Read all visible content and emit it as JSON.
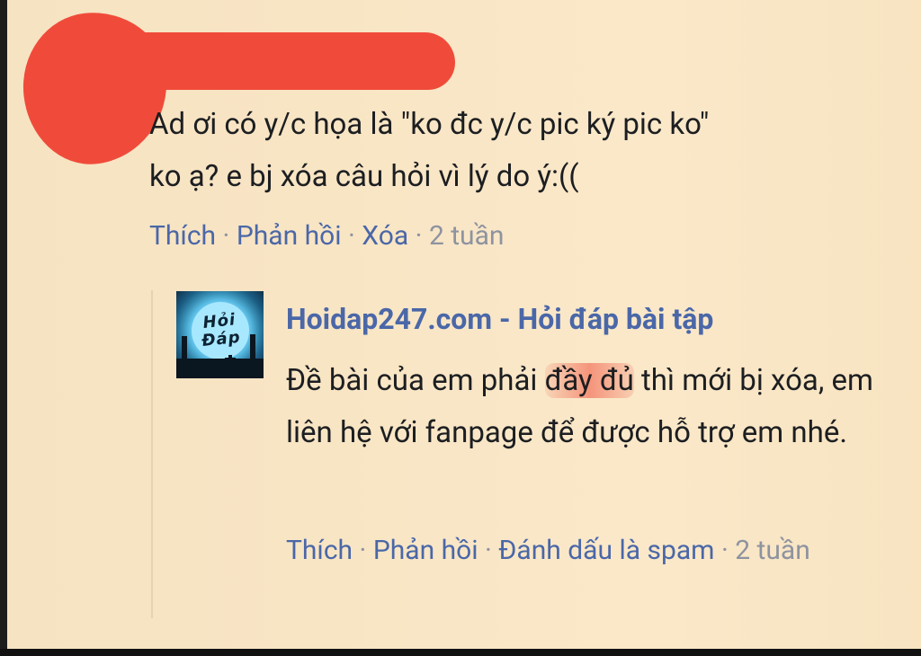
{
  "comment": {
    "author_redacted": true,
    "line1": "Ad ơi có y/c họa là \"ko đc y/c pic ký pic ko\"",
    "line2": "ko ạ? e bj xóa câu hỏi vì lý do ý:((",
    "actions": {
      "like": "Thích",
      "reply": "Phản hồi",
      "delete": "Xóa",
      "time": "2 tuần"
    }
  },
  "reply": {
    "avatar_icon": "hoidap-logo",
    "avatar_text": "Hỏi Đáp",
    "author": "Hoidap247.com - Hỏi đáp bài tập",
    "text_part1": "Đề bài của em phải ",
    "text_highlight": "đầy đủ",
    "text_part2": " thì mới bị xóa, em liên hệ với fanpage để được hỗ trợ em nhé.",
    "actions": {
      "like": "Thích",
      "reply": "Phản hồi",
      "spam": "Đánh dấu là spam",
      "time": "2 tuần"
    }
  },
  "colors": {
    "background": "#f8e5c4",
    "link": "#4a67a8",
    "muted": "#8e93a0",
    "redaction": "#f04b3a"
  }
}
